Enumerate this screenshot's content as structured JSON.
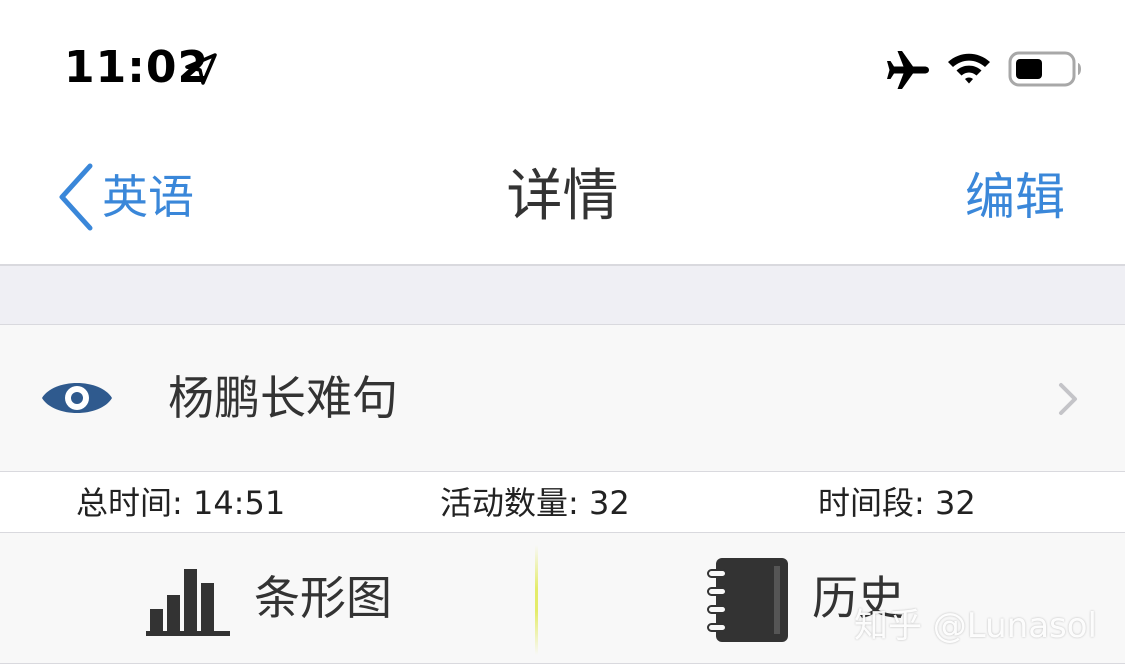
{
  "status_bar": {
    "time": "11:02",
    "icons": [
      "location-arrow-icon",
      "airplane-icon",
      "wifi-icon",
      "battery-icon"
    ],
    "battery_level": 0.5
  },
  "nav_bar": {
    "back_label": "英语",
    "title": "详情",
    "edit_label": "编辑"
  },
  "item": {
    "icon": "eye-icon",
    "title": "杨鹏长难句"
  },
  "stats": {
    "total_time": "总时间: 14:51",
    "activity_count": "活动数量: 32",
    "time_slots": "时间段: 32"
  },
  "tabs": {
    "chart_label": "条形图",
    "history_label": "历史"
  },
  "watermark": "知乎 @Lunasol",
  "colors": {
    "accent": "#3a87d9",
    "eye_icon": "#2f5a8e",
    "group_background": "#efeff4",
    "row_background": "#f8f8f8",
    "divider": "#d9d9de",
    "dark_icon": "#333333"
  }
}
